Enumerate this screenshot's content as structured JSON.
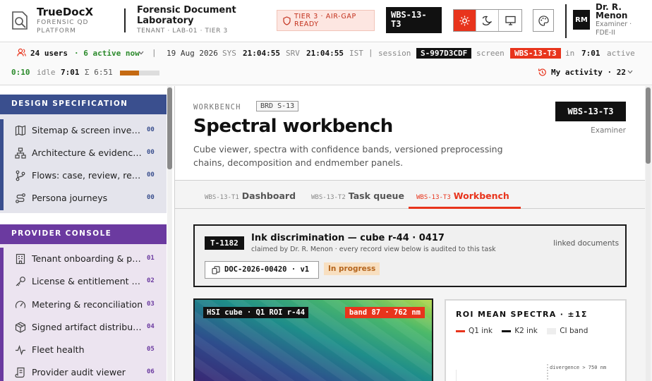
{
  "header": {
    "brand": {
      "name": "TrueDocX",
      "subtitle": "FORENSIC QD PLATFORM"
    },
    "org": {
      "name": "Forensic Document Laboratory",
      "subtitle": "TENANT · LAB-01 · TIER 3"
    },
    "tier_badge": "TIER 3 · AIR-GAP READY",
    "wbs_code": "WBS-13-T3",
    "theme_buttons": [
      {
        "icon": "sun-icon",
        "active": true
      },
      {
        "icon": "moon-icon",
        "active": false
      },
      {
        "icon": "monitor-icon",
        "active": false
      }
    ],
    "palette_icon": "palette-icon",
    "user": {
      "initials": "RM",
      "name": "Dr. R. Menon",
      "role": "Examiner · FDE-II"
    }
  },
  "statusbar": {
    "users": "24 users",
    "active": "· 6 active now",
    "date": "19 Aug 2026",
    "sys_label": "SYS",
    "sys_time": "21:04:55",
    "srv_label": "SRV",
    "srv_time": "21:04:55",
    "tz": "IST",
    "session_label": "session",
    "session_id": "S-997D3CDF",
    "screen_label": "screen",
    "screen_id": "WBS-13-T3",
    "in_label": "in",
    "in_time": "7:01",
    "active_label": "active",
    "active_time": "0:10",
    "idle_label": "idle",
    "idle_time": "7:01",
    "sum_label": "Σ 6:51",
    "progress": 0.48,
    "my_activity": "My activity · 22"
  },
  "sidebar": {
    "sections": [
      {
        "title": "DESIGN SPECIFICATION",
        "color": "#3a4f8e",
        "panel": "#e4e4ec",
        "items": [
          {
            "label": "Sitemap & screen inventory",
            "num": "00",
            "icon": "map-icon"
          },
          {
            "label": "Architecture & evidence s...",
            "num": "00",
            "icon": "network-icon"
          },
          {
            "label": "Flows: case, review, report",
            "num": "00",
            "icon": "flow-icon"
          },
          {
            "label": "Persona journeys",
            "num": "00",
            "icon": "route-icon"
          }
        ]
      },
      {
        "title": "PROVIDER CONSOLE",
        "color": "#6b3aa0",
        "panel": "#ece4f0",
        "items": [
          {
            "label": "Tenant onboarding & prov...",
            "num": "01",
            "icon": "building-icon"
          },
          {
            "label": "License & entitlement ma...",
            "num": "02",
            "icon": "key-icon"
          },
          {
            "label": "Metering & reconciliation",
            "num": "03",
            "icon": "gauge-icon"
          },
          {
            "label": "Signed artifact distribution",
            "num": "04",
            "icon": "package-icon"
          },
          {
            "label": "Fleet health",
            "num": "05",
            "icon": "pulse-icon"
          },
          {
            "label": "Provider audit viewer",
            "num": "06",
            "icon": "scroll-icon"
          }
        ]
      }
    ]
  },
  "main": {
    "eyebrow": "WORKBENCH",
    "brd_tag": "BRD S-13",
    "title": "Spectral workbench",
    "description": "Cube viewer, spectra with confidence bands, versioned preprocessing chains, decomposition and endmember panels.",
    "wbs_code": "WBS-13-T3",
    "role": "Examiner",
    "tabs": [
      {
        "code": "WBS-13-T1",
        "name": "Dashboard",
        "active": false
      },
      {
        "code": "WBS-13-T2",
        "name": "Task queue",
        "active": false
      },
      {
        "code": "WBS-13-T3",
        "name": "Workbench",
        "active": true
      }
    ],
    "task": {
      "id": "T-1182",
      "title": "Ink discrimination — cube r-44 · 0417",
      "claimed": "claimed by Dr. R. Menon · every record view below is audited to this task",
      "linked_label": "linked documents",
      "doc": "DOC-2026-00420 · v1",
      "status": "In progress"
    },
    "cube": {
      "label": "HSI cube · Q1 ROI r-44",
      "band": "band 87 · 762 nm"
    },
    "spectra": {
      "title": "ROI MEAN SPECTRA · ±1Σ",
      "legend": [
        "Q1 ink",
        "K2 ink",
        "CI band"
      ],
      "annotation": "divergence > 750 nm"
    }
  },
  "colors": {
    "accent": "#e8341c",
    "active_green": "#2b8a2b",
    "progress": "#c56a12",
    "status_pill_bg": "#f8dfc0",
    "status_pill_fg": "#b5651d"
  }
}
